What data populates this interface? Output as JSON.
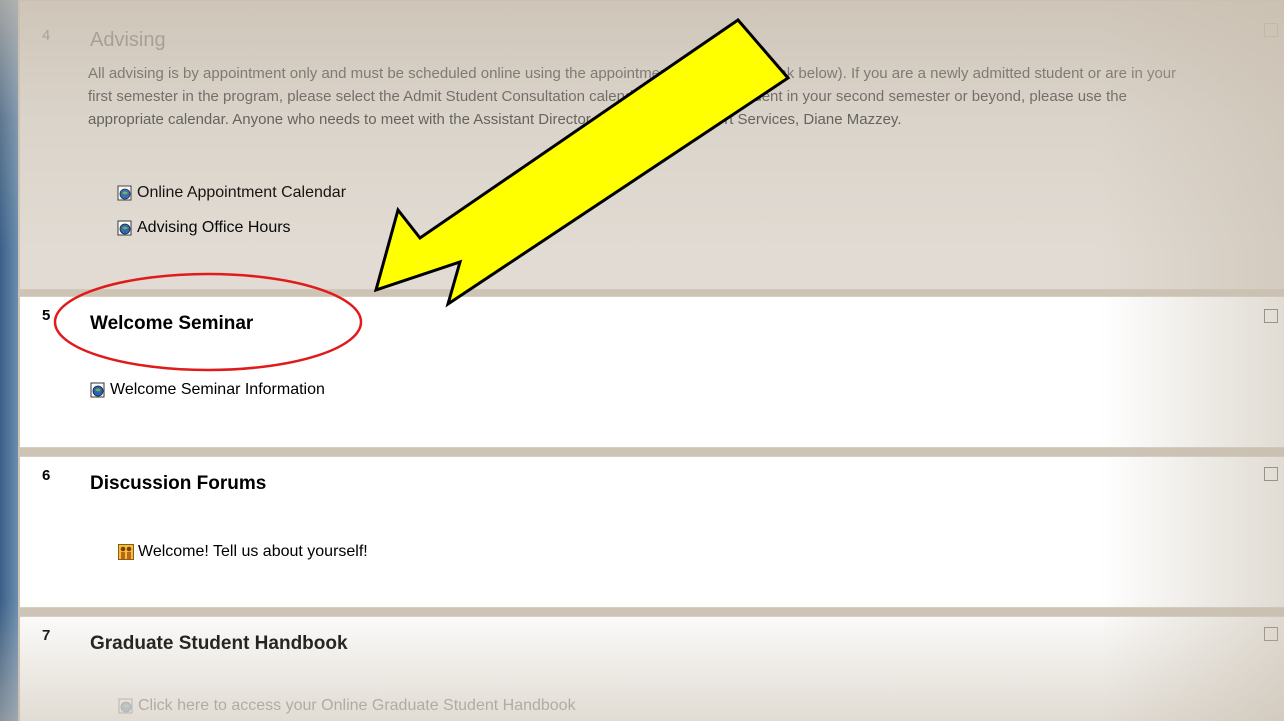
{
  "sections": [
    {
      "number": "4",
      "title": "Advising",
      "description": "All advising is by appointment only and must be scheduled online using the appointment calendar (see link below). If you are a newly admitted student or are in your first semester in the program, please select the Admit Student Consultation calendar. If you are a student in your second semester or beyond, please use the appropriate calendar. Anyone who needs to meet with the Assistant Director of Academic Support Services, Diane Mazzey.",
      "links": [
        "Online Appointment Calendar",
        "Advising Office Hours"
      ]
    },
    {
      "number": "5",
      "title": "Welcome Seminar",
      "links": [
        "Welcome Seminar Information"
      ]
    },
    {
      "number": "6",
      "title": "Discussion Forums",
      "links": [
        "Welcome! Tell us about yourself!"
      ]
    },
    {
      "number": "7",
      "title": "Graduate Student Handbook",
      "links": [
        "Click here to access your Online Graduate Student Handbook"
      ]
    }
  ],
  "icons": {
    "resource": "globe-page-icon",
    "forum": "forum-people-icon"
  },
  "colors": {
    "arrow_fill": "#ffff00",
    "highlight_ellipse": "#e01b1b",
    "left_bar": "#4a6f96"
  }
}
